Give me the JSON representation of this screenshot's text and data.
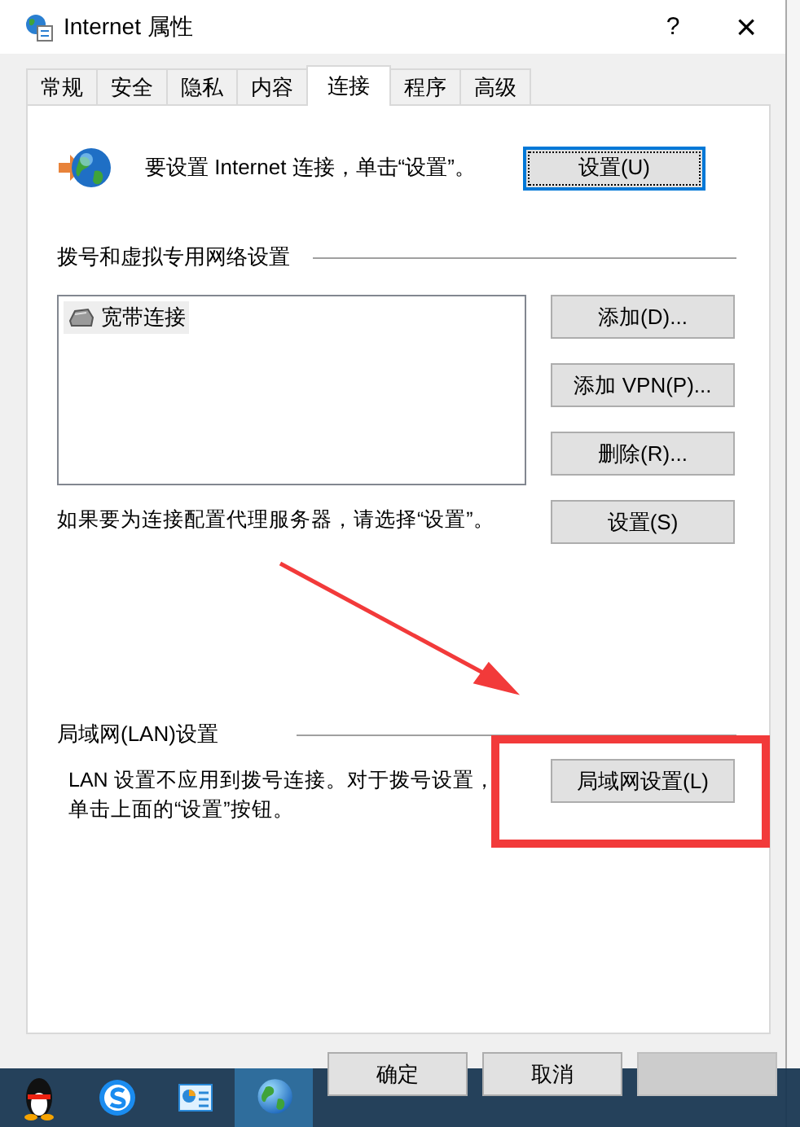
{
  "window": {
    "title": "Internet 属性",
    "help": "?",
    "close": "×"
  },
  "tabs": [
    {
      "label": "常规",
      "selected": false
    },
    {
      "label": "安全",
      "selected": false
    },
    {
      "label": "隐私",
      "selected": false
    },
    {
      "label": "内容",
      "selected": false
    },
    {
      "label": "连接",
      "selected": true
    },
    {
      "label": "程序",
      "selected": false
    },
    {
      "label": "高级",
      "selected": false
    }
  ],
  "setup": {
    "text": "要设置 Internet 连接，单击“设置”。",
    "button": "设置(U)",
    "focused": true
  },
  "dialup": {
    "heading": "拨号和虚拟专用网络设置",
    "connections": [
      {
        "name": "宽带连接",
        "selected": true
      }
    ],
    "buttons": [
      "添加(D)...",
      "添加 VPN(P)...",
      "删除(R)...",
      "设置(S)"
    ],
    "proxy_note": "如果要为连接配置代理服务器，请选择“设置”。"
  },
  "lan": {
    "heading": "局域网(LAN)设置",
    "note": "LAN 设置不应用到拨号连接。对于拨号设置，单击上面的“设置”按钮。",
    "button": "局域网设置(L)"
  },
  "footer_buttons": [
    {
      "label": "确定",
      "disabled": false
    },
    {
      "label": "取消",
      "disabled": false
    },
    {
      "disabled": true
    }
  ],
  "taskbar": {
    "apps": [
      {
        "kind": "penguin",
        "active": false
      },
      {
        "kind": "browser",
        "active": false
      },
      {
        "kind": "panel",
        "active": false
      },
      {
        "kind": "globe",
        "active": true
      }
    ]
  }
}
